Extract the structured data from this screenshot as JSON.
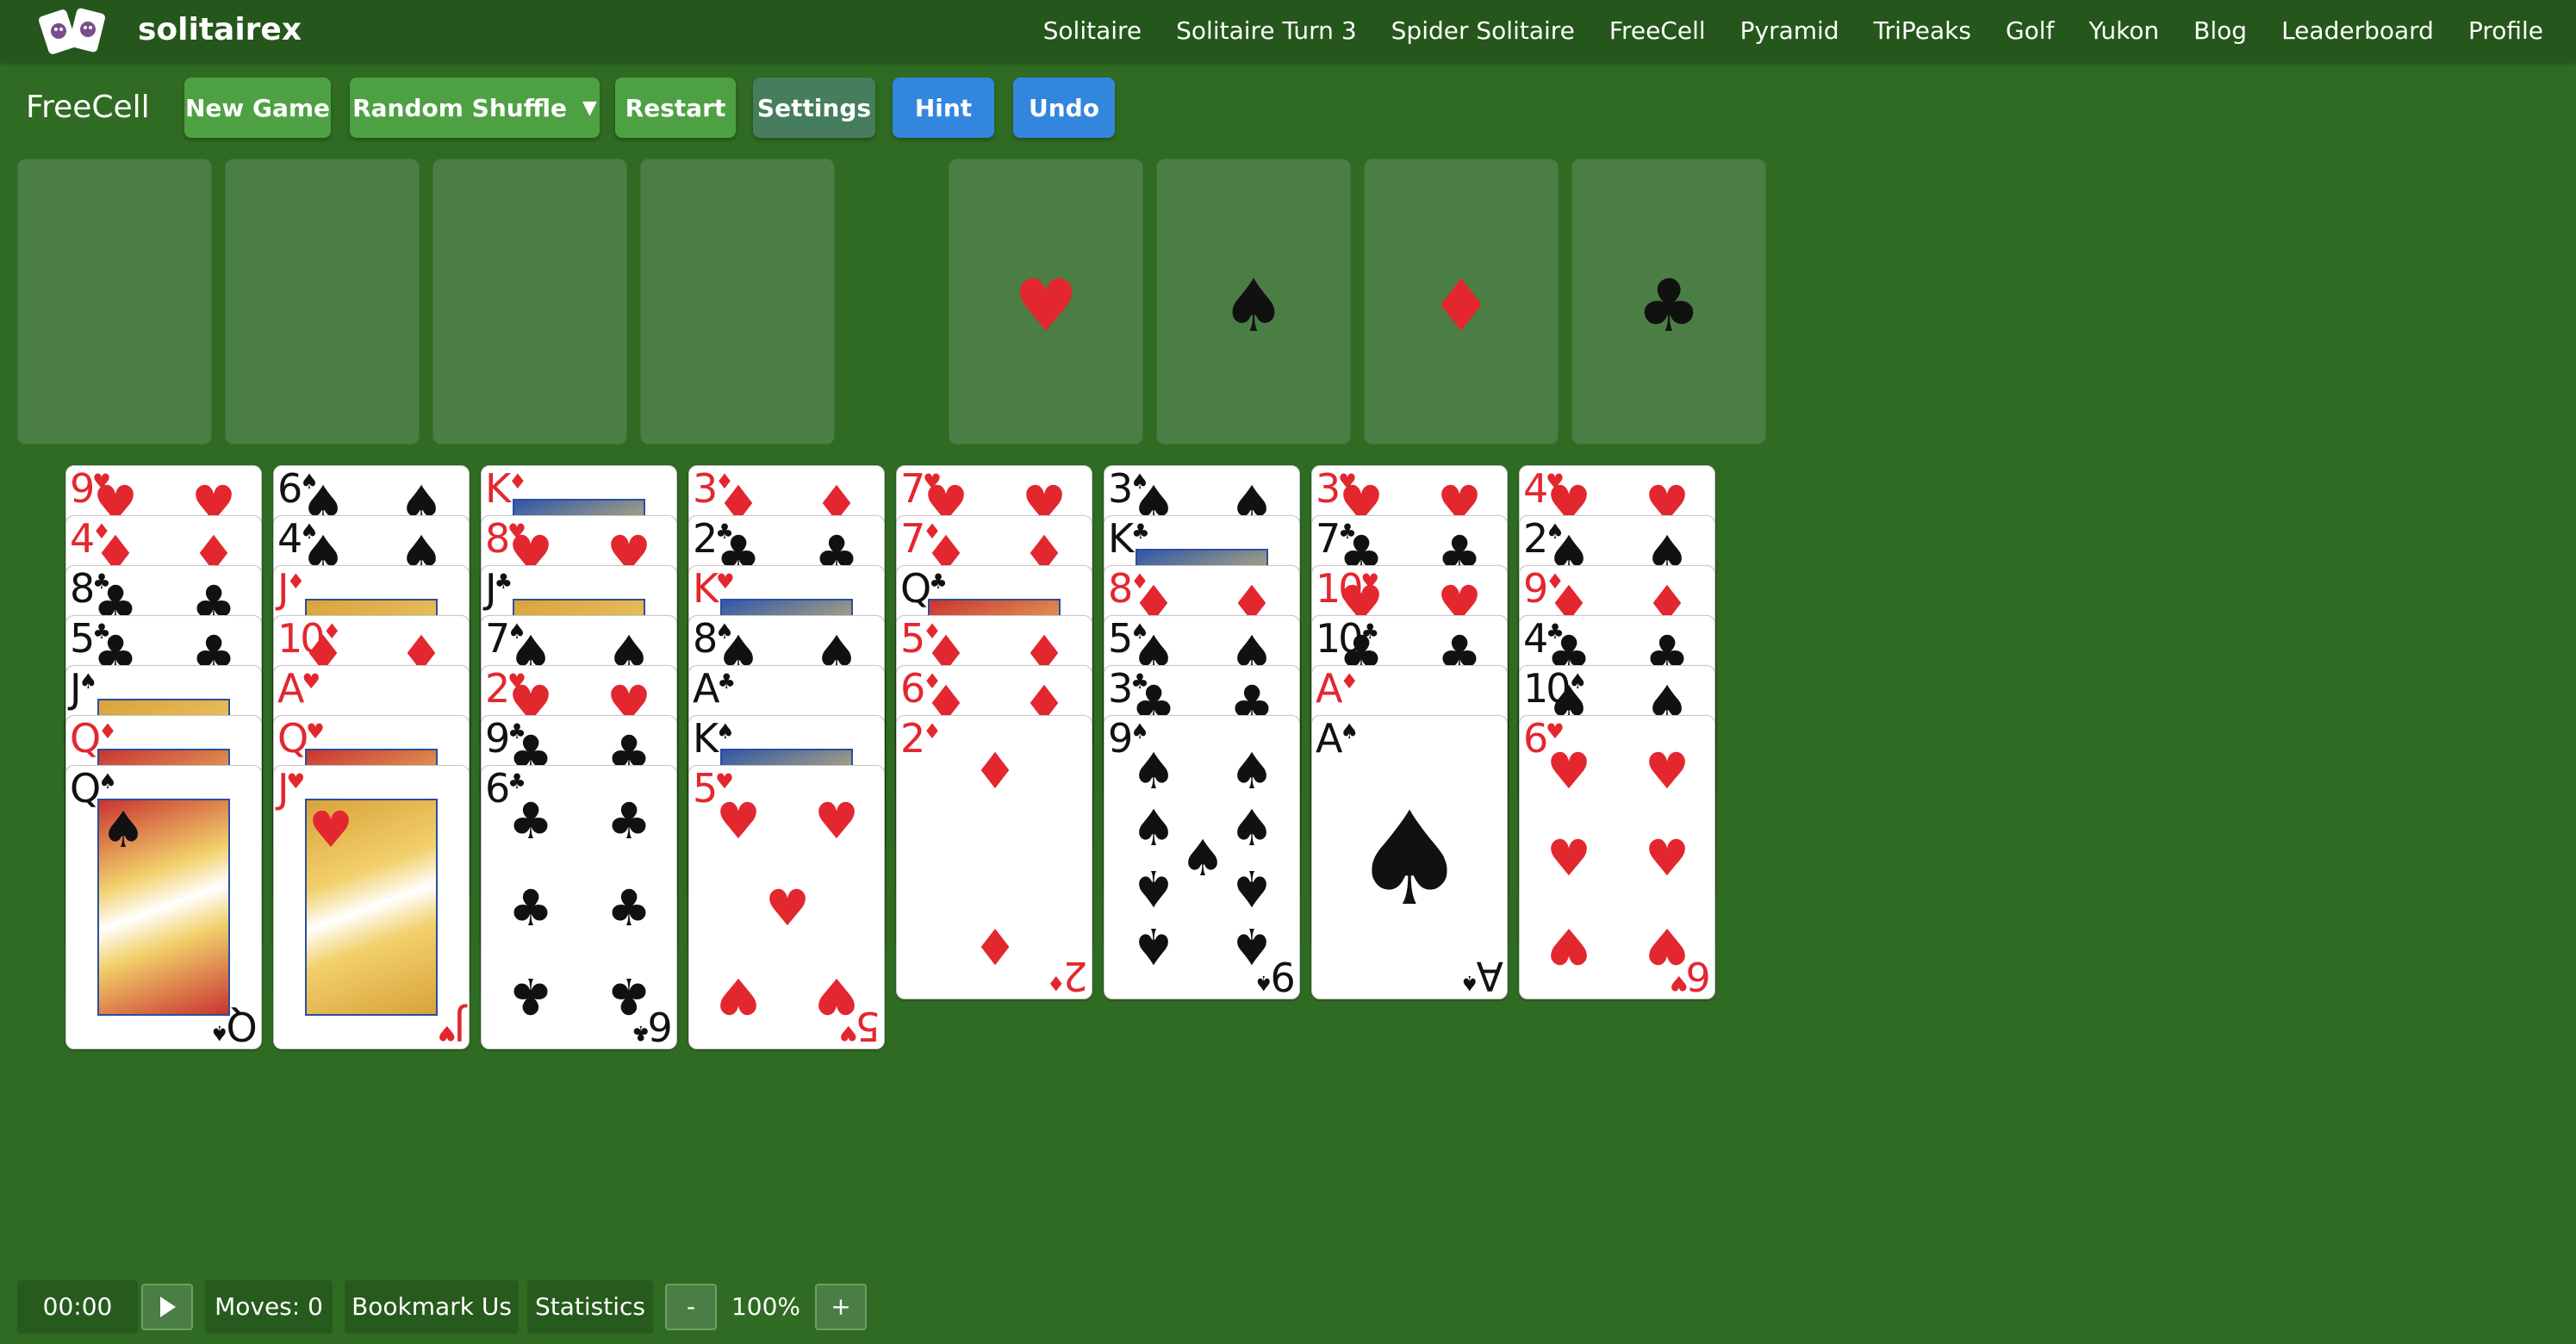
{
  "site": {
    "brand": "solitairex",
    "logo_icon": "playing-cards-logo-icon",
    "nav": [
      "Solitaire",
      "Solitaire Turn 3",
      "Spider Solitaire",
      "FreeCell",
      "Pyramid",
      "TriPeaks",
      "Golf",
      "Yukon",
      "Blog",
      "Leaderboard",
      "Profile"
    ]
  },
  "toolbar": {
    "game_title": "FreeCell",
    "new_game": "New Game",
    "random_shuffle": "Random Shuffle",
    "random_shuffle_caret": "▼",
    "restart": "Restart",
    "settings": "Settings",
    "hint": "Hint",
    "undo": "Undo"
  },
  "free_cells": [
    null,
    null,
    null,
    null
  ],
  "foundations": [
    {
      "suit": "♥",
      "color": "red",
      "icon": "heart-icon"
    },
    {
      "suit": "♠",
      "color": "black",
      "icon": "spade-icon"
    },
    {
      "suit": "♦",
      "color": "red",
      "icon": "diamond-icon"
    },
    {
      "suit": "♣",
      "color": "black",
      "icon": "club-icon"
    }
  ],
  "tableau": [
    [
      {
        "rank": "9",
        "suit": "♥"
      },
      {
        "rank": "4",
        "suit": "♦"
      },
      {
        "rank": "8",
        "suit": "♣"
      },
      {
        "rank": "5",
        "suit": "♣"
      },
      {
        "rank": "J",
        "suit": "♠"
      },
      {
        "rank": "Q",
        "suit": "♦"
      },
      {
        "rank": "Q",
        "suit": "♠"
      }
    ],
    [
      {
        "rank": "6",
        "suit": "♠"
      },
      {
        "rank": "4",
        "suit": "♠"
      },
      {
        "rank": "J",
        "suit": "♦"
      },
      {
        "rank": "10",
        "suit": "♦"
      },
      {
        "rank": "A",
        "suit": "♥"
      },
      {
        "rank": "Q",
        "suit": "♥"
      },
      {
        "rank": "J",
        "suit": "♥"
      }
    ],
    [
      {
        "rank": "K",
        "suit": "♦"
      },
      {
        "rank": "8",
        "suit": "♥"
      },
      {
        "rank": "J",
        "suit": "♣"
      },
      {
        "rank": "7",
        "suit": "♠"
      },
      {
        "rank": "2",
        "suit": "♥"
      },
      {
        "rank": "9",
        "suit": "♣"
      },
      {
        "rank": "6",
        "suit": "♣"
      }
    ],
    [
      {
        "rank": "3",
        "suit": "♦"
      },
      {
        "rank": "2",
        "suit": "♣"
      },
      {
        "rank": "K",
        "suit": "♥"
      },
      {
        "rank": "8",
        "suit": "♠"
      },
      {
        "rank": "A",
        "suit": "♣"
      },
      {
        "rank": "K",
        "suit": "♠"
      },
      {
        "rank": "5",
        "suit": "♥"
      }
    ],
    [
      {
        "rank": "7",
        "suit": "♥"
      },
      {
        "rank": "7",
        "suit": "♦"
      },
      {
        "rank": "Q",
        "suit": "♣"
      },
      {
        "rank": "5",
        "suit": "♦"
      },
      {
        "rank": "6",
        "suit": "♦"
      },
      {
        "rank": "2",
        "suit": "♦"
      }
    ],
    [
      {
        "rank": "3",
        "suit": "♠"
      },
      {
        "rank": "K",
        "suit": "♣"
      },
      {
        "rank": "8",
        "suit": "♦"
      },
      {
        "rank": "5",
        "suit": "♠"
      },
      {
        "rank": "3",
        "suit": "♣"
      },
      {
        "rank": "9",
        "suit": "♠"
      }
    ],
    [
      {
        "rank": "3",
        "suit": "♥"
      },
      {
        "rank": "7",
        "suit": "♣"
      },
      {
        "rank": "10",
        "suit": "♥"
      },
      {
        "rank": "10",
        "suit": "♣"
      },
      {
        "rank": "A",
        "suit": "♦"
      },
      {
        "rank": "A",
        "suit": "♠"
      }
    ],
    [
      {
        "rank": "4",
        "suit": "♥"
      },
      {
        "rank": "2",
        "suit": "♠"
      },
      {
        "rank": "9",
        "suit": "♦"
      },
      {
        "rank": "4",
        "suit": "♣"
      },
      {
        "rank": "10",
        "suit": "♠"
      },
      {
        "rank": "6",
        "suit": "♥"
      }
    ]
  ],
  "status": {
    "timer": "00:00",
    "play_icon": "play-icon",
    "moves": "Moves: 0",
    "bookmark": "Bookmark Us",
    "statistics": "Statistics",
    "zoom_out": "-",
    "zoom": "100%",
    "zoom_in": "+"
  },
  "colors": {
    "felt": "#2f6b22",
    "nav_bg": "#25561b",
    "slot_bg": "#4a7e44",
    "button_green": "#4ea142",
    "button_teal": "#467d5c",
    "button_blue": "#3386dd",
    "suit_red": "#e3272f",
    "suit_black": "#111111"
  }
}
